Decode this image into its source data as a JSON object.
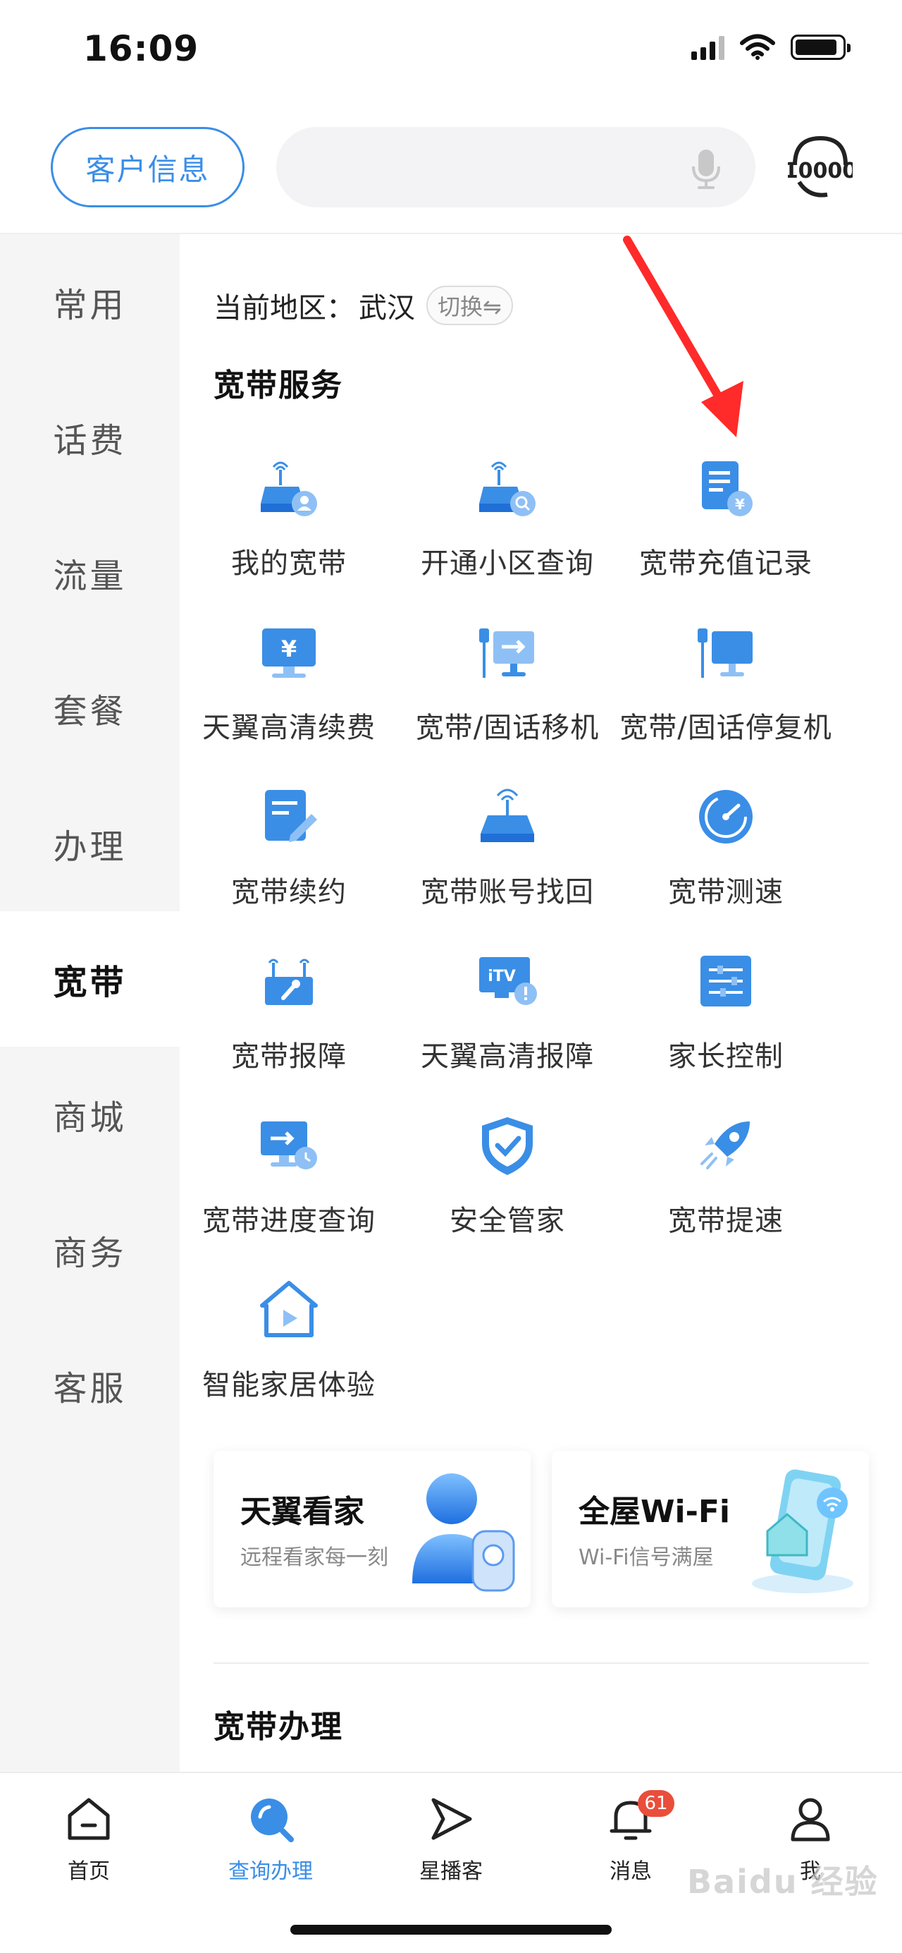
{
  "status_bar": {
    "time": "16:09",
    "battery_level": 0.9
  },
  "header": {
    "customer_info_label": "客户信息",
    "search_placeholder": "",
    "mic_icon": "microphone-icon",
    "service_icon": "10000-customer-service-icon"
  },
  "sidebar": {
    "items": [
      {
        "label": "常用",
        "active": false
      },
      {
        "label": "话费",
        "active": false
      },
      {
        "label": "流量",
        "active": false
      },
      {
        "label": "套餐",
        "active": false
      },
      {
        "label": "办理",
        "active": false
      },
      {
        "label": "宽带",
        "active": true
      },
      {
        "label": "商城",
        "active": false
      },
      {
        "label": "商务",
        "active": false
      },
      {
        "label": "客服",
        "active": false
      }
    ]
  },
  "region": {
    "label": "当前地区：",
    "city": "武汉",
    "switch_label": "切换⇋"
  },
  "broadband_services": {
    "title": "宽带服务",
    "items": [
      {
        "label": "我的宽带",
        "icon": "router-user-icon"
      },
      {
        "label": "开通小区查询",
        "icon": "router-search-icon"
      },
      {
        "label": "宽带充值记录",
        "icon": "document-yuan-icon"
      },
      {
        "label": "天翼高清续费",
        "icon": "monitor-yuan-icon"
      },
      {
        "label": "宽带/固话移机",
        "icon": "phone-transfer-icon"
      },
      {
        "label": "宽带/固话停复机",
        "icon": "phone-monitor-icon"
      },
      {
        "label": "宽带续约",
        "icon": "edit-document-icon"
      },
      {
        "label": "宽带账号找回",
        "icon": "router-icon"
      },
      {
        "label": "宽带测速",
        "icon": "speedometer-icon"
      },
      {
        "label": "宽带报障",
        "icon": "router-wrench-icon"
      },
      {
        "label": "天翼高清报障",
        "icon": "itv-alert-icon"
      },
      {
        "label": "家长控制",
        "icon": "settings-panel-icon"
      },
      {
        "label": "宽带进度查询",
        "icon": "monitor-clock-icon"
      },
      {
        "label": "安全管家",
        "icon": "shield-check-icon"
      },
      {
        "label": "宽带提速",
        "icon": "rocket-icon"
      },
      {
        "label": "智能家居体验",
        "icon": "smart-home-play-icon"
      }
    ]
  },
  "promos": [
    {
      "title": "天翼看家",
      "subtitle": "远程看家每一刻",
      "icon": "person-camera-icon"
    },
    {
      "title": "全屋Wi-Fi",
      "subtitle": "Wi-Fi信号满屋",
      "icon": "wifi-house-icon"
    }
  ],
  "broadband_handling": {
    "title": "宽带办理"
  },
  "tabbar": {
    "items": [
      {
        "label": "首页",
        "icon": "home-icon",
        "active": false
      },
      {
        "label": "查询办理",
        "icon": "search-icon",
        "active": true
      },
      {
        "label": "星播客",
        "icon": "play-arrow-icon",
        "active": false
      },
      {
        "label": "消息",
        "icon": "bell-icon",
        "active": false,
        "badge": "61"
      },
      {
        "label": "我",
        "icon": "user-icon",
        "active": false
      }
    ]
  },
  "watermark": "Baidu 经验",
  "colors": {
    "accent": "#3a8ee6",
    "badge": "#e94e3b",
    "arrow": "#ff2a2a"
  }
}
